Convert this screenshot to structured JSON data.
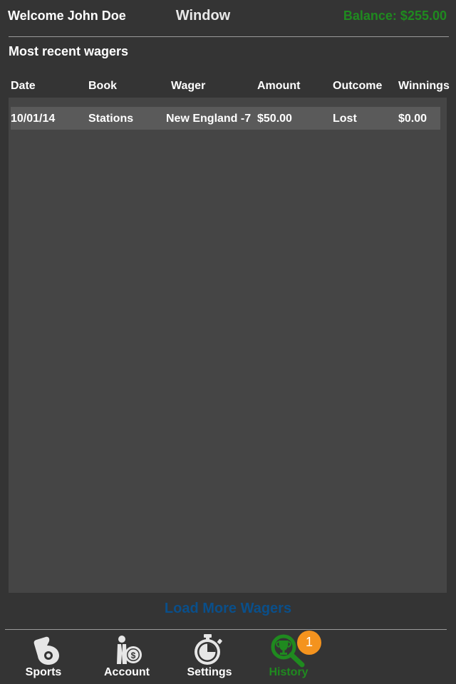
{
  "header": {
    "welcome": "Welcome John Doe",
    "window_title": "Window",
    "balance": "Balance: $255.00"
  },
  "section_title": "Most recent wagers",
  "table": {
    "columns": [
      "Date",
      "Book",
      "Wager",
      "Amount",
      "Outcome",
      "Winnings"
    ],
    "rows": [
      {
        "date": "10/01/14",
        "book": "Stations",
        "wager": "New England -7",
        "amount": "$50.00",
        "outcome": "Lost",
        "winnings": "$0.00"
      }
    ]
  },
  "load_more": "Load More Wagers",
  "nav": {
    "items": [
      {
        "label": "Sports",
        "icon": "whistle-icon"
      },
      {
        "label": "Account",
        "icon": "person-money-icon"
      },
      {
        "label": "Settings",
        "icon": "stopwatch-icon"
      },
      {
        "label": "History",
        "icon": "magnifier-trophy-icon",
        "active": true
      }
    ],
    "badge": "1"
  },
  "colors": {
    "background": "#343434",
    "panel": "#454545",
    "row": "#5a5a5a",
    "accent_green": "#1f8a1f",
    "link_blue": "#0a4f8a",
    "badge_orange": "#f4931e"
  }
}
